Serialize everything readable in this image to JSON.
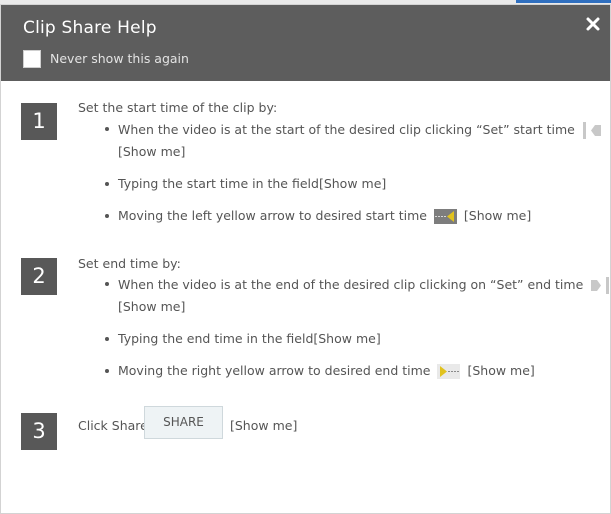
{
  "dialog": {
    "title": "Clip Share Help",
    "never_show_label": "Never show this again",
    "close_glyph": "✖"
  },
  "steps": [
    {
      "number": "1",
      "heading": "Set the start time of the clip by:",
      "bullets": [
        {
          "text": "When the video is at the start of the desired clip clicking “Set” start time",
          "icon": "set-start-icon",
          "show_me": "[Show me]"
        },
        {
          "text": "Typing the start time in the field",
          "show_me": "[Show me]"
        },
        {
          "text": "Moving the left yellow arrow to desired start time",
          "icon": "left-yellow-arrow-icon",
          "show_me": "[Show me]"
        }
      ]
    },
    {
      "number": "2",
      "heading": "Set end time by:",
      "bullets": [
        {
          "text": "When the video is at the end of the desired clip clicking on “Set” end time",
          "icon": "set-end-icon",
          "show_me": "[Show me]"
        },
        {
          "text": "Typing the end time in the field",
          "show_me": "[Show me]"
        },
        {
          "text": "Moving the right yellow arrow to desired end time",
          "icon": "right-yellow-arrow-icon",
          "show_me": "[Show me]"
        }
      ]
    },
    {
      "number": "3",
      "heading": "Click Share",
      "button_label": "SHARE",
      "show_me": "[Show me]"
    }
  ],
  "colors": {
    "header_bg": "#5d5d5d",
    "step_badge_bg": "#585858",
    "arrow_yellow": "#e1c21e",
    "accent_blue": "#2f6fbf"
  }
}
